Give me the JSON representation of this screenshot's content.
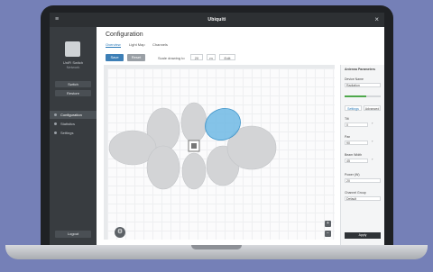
{
  "app": {
    "title": "Ubiquiti",
    "menu_icon": "menu-icon",
    "close_icon": "close-icon"
  },
  "sidebar": {
    "device_name": "UniFi Switch",
    "device_sub": "Network",
    "buttons": [
      "Switch",
      "Restore"
    ],
    "nav": [
      {
        "label": "Configuration",
        "icon": "config-icon",
        "active": true
      },
      {
        "label": "Statistics",
        "icon": "stats-icon",
        "active": false
      },
      {
        "label": "Settings",
        "icon": "settings-icon",
        "active": false
      }
    ],
    "bottom_button": "Logout"
  },
  "main": {
    "title": "Configuration",
    "tabs": [
      "Overview",
      "Light Map",
      "Channels"
    ],
    "toolbar": {
      "primary": "Save",
      "secondary": "Reset",
      "label": "Scale drawing to",
      "inputs": [
        "20",
        "m",
        "Edit"
      ]
    }
  },
  "right_panel": {
    "title": "Antenna Parameters",
    "name_label": "Device Name",
    "name_value": "Radiation",
    "progress_fraction": 0.6,
    "tabs": [
      "Settings",
      "Advanced"
    ],
    "fields": [
      {
        "label": "Tilt",
        "value": "0",
        "unit": "°"
      },
      {
        "label": "Pan",
        "value": "90",
        "unit": "°"
      },
      {
        "label": "Beam Width",
        "value": "45",
        "unit": "°"
      }
    ],
    "power_label": "Power (W)",
    "power_value": "20",
    "channel_label": "Channel Group",
    "channel_value": "Default",
    "apply_button": "Apply"
  },
  "colors": {
    "accent": "#3d7fb6",
    "selected_zone": "#5aaee0",
    "zone": "#d3d4d6"
  }
}
